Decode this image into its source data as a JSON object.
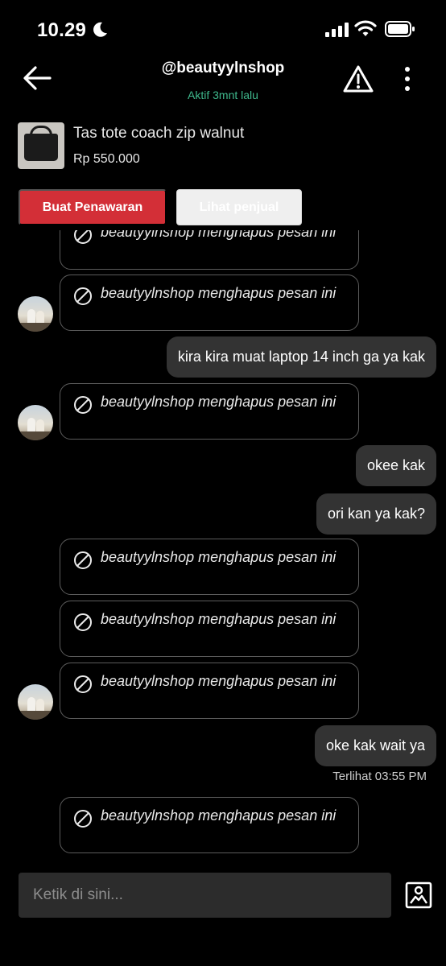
{
  "status": {
    "time": "10.29"
  },
  "header": {
    "title": "@beautyylnshop",
    "subtitle": "Aktif 3mnt lalu"
  },
  "product": {
    "name": "Tas tote coach zip walnut",
    "price": "Rp 550.000"
  },
  "actions": {
    "offer_label": "Buat Penawaran",
    "seller_label": "Lihat penjual"
  },
  "messages": {
    "deleted_text": "beautyylnshop menghapus pesan ini",
    "sent_1": "kira kira muat laptop 14 inch ga ya kak",
    "sent_2": "okee kak",
    "sent_3": "ori kan ya kak?",
    "sent_4": "oke kak wait ya",
    "seen": "Terlihat 03:55 PM"
  },
  "composer": {
    "placeholder": "Ketik di sini..."
  },
  "colors": {
    "accent": "#d32f37",
    "online": "#3fb98d",
    "bubble": "#333333",
    "background": "#000000"
  },
  "icons": [
    "moon-icon",
    "signal-icon",
    "wifi-icon",
    "battery-icon",
    "back-arrow-icon",
    "warning-icon",
    "more-icon",
    "ban-icon",
    "image-upload-icon"
  ]
}
